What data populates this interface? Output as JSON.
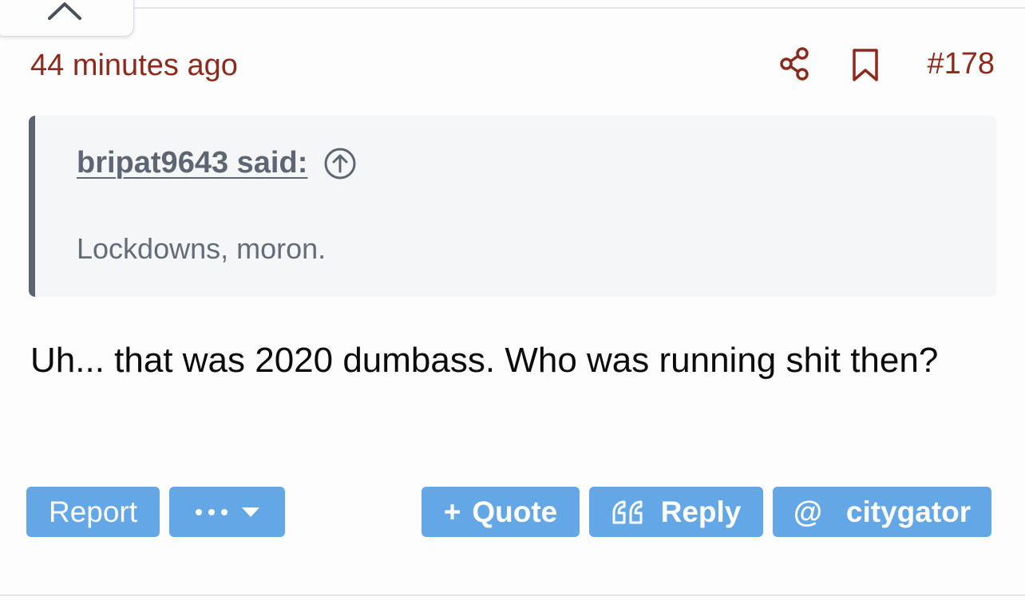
{
  "post": {
    "timestamp": "44 minutes ago",
    "post_number": "#178"
  },
  "quote": {
    "author_label": "bripat9643 said:",
    "text": "Lockdowns, moron."
  },
  "message": {
    "body": "Uh... that was 2020 dumbass. Who was running shit then?"
  },
  "actions": {
    "report_label": "Report",
    "quote_symbol": "+",
    "quote_label": "Quote",
    "reply_label": "Reply",
    "mention_symbol": "@",
    "mention_label": "citygator"
  },
  "icons": {
    "collapse": "chevron-up-icon",
    "share": "share-icon",
    "bookmark": "bookmark-icon",
    "jump_to_quote": "arrow-up-circle-icon",
    "more": "ellipsis-icon",
    "dropdown": "caret-down-icon",
    "reply": "quote-marks-icon"
  },
  "colors": {
    "accent_red": "#8c2a1c",
    "button_blue": "#64a7e6",
    "quote_bar": "#5b6270",
    "quote_bg": "#f5f6f8"
  }
}
